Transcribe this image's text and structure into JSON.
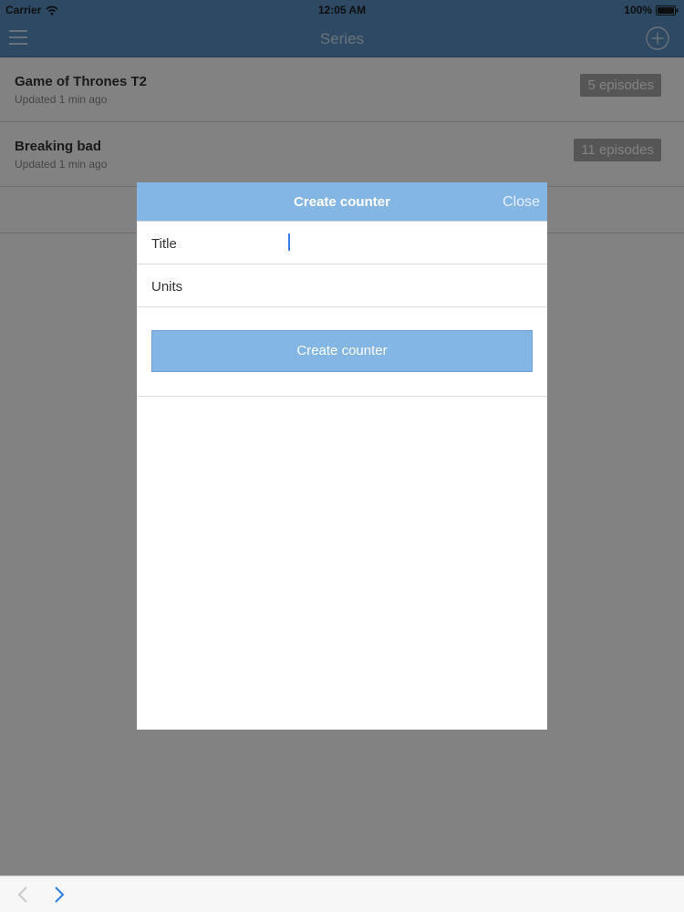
{
  "status_bar": {
    "carrier": "Carrier",
    "time": "12:05 AM",
    "battery": "100%"
  },
  "nav_bar": {
    "title": "Series",
    "left_icon": "menu-icon",
    "right_icon": "add-circle-icon"
  },
  "series": [
    {
      "title": "Game of Thrones T2",
      "updated": "Updated 1 min ago",
      "episodes": "5 episodes"
    },
    {
      "title": "Breaking bad",
      "updated": "Updated 1 min ago",
      "episodes": "11 episodes"
    }
  ],
  "modal": {
    "title": "Create counter",
    "close_label": "Close",
    "fields": {
      "title_label": "Title",
      "title_value": "",
      "units_label": "Units",
      "units_value": ""
    },
    "submit_label": "Create counter"
  },
  "toolbar": {
    "back_icon": "chevron-left-icon",
    "forward_icon": "chevron-right-icon"
  },
  "colors": {
    "nav_bar": "#5a8fc4",
    "modal_accent": "#84b6e4",
    "caret": "#3f7ee8",
    "badge": "#a9a9a9"
  }
}
